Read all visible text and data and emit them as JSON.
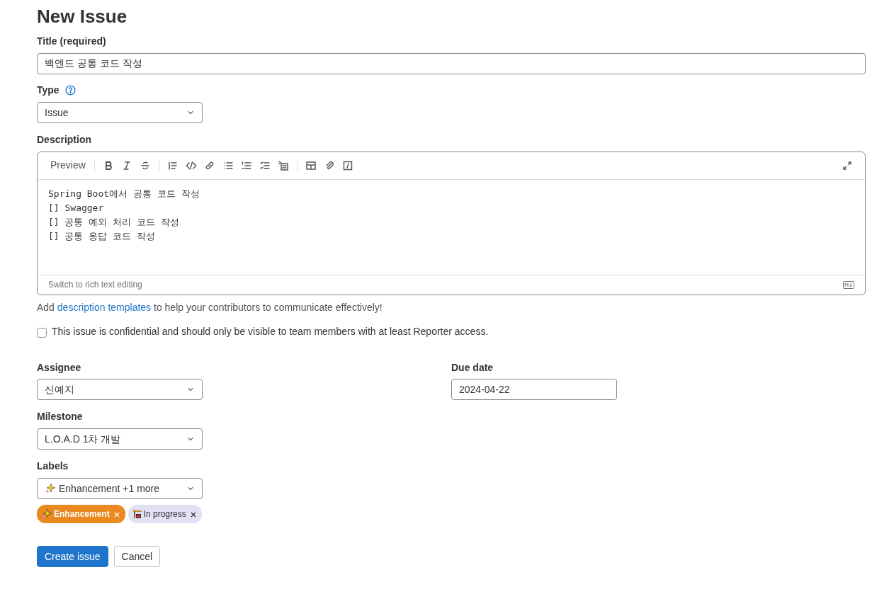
{
  "page_title": "New Issue",
  "title_field": {
    "label": "Title (required)",
    "value": "백엔드 공통 코드 작성"
  },
  "type_field": {
    "label": "Type",
    "value": "Issue"
  },
  "description": {
    "label": "Description",
    "preview_tab": "Preview",
    "content": "Spring Boot에서 공통 코드 작성\n[] Swagger\n[] 공통 예외 처리 코드 작성\n[] 공통 응답 코드 작성",
    "switch_link": "Switch to rich text editing"
  },
  "templates_hint": {
    "before": "Add ",
    "link": "description templates",
    "after": " to help your contributors to communicate effectively!"
  },
  "confidential": {
    "label": "This issue is confidential and should only be visible to team members with at least Reporter access.",
    "checked": false
  },
  "assignee": {
    "label": "Assignee",
    "value": "신예지"
  },
  "due_date": {
    "label": "Due date",
    "value": "2024-04-22"
  },
  "milestone": {
    "label": "Milestone",
    "value": "L.O.A.D 1차 개발"
  },
  "labels": {
    "label": "Labels",
    "dropdown_value": "Enhancement +1 more",
    "items": [
      {
        "name": "Enhancement",
        "color": "#e9891f"
      },
      {
        "name": "In progress",
        "color": "#e1e0f5"
      }
    ]
  },
  "buttons": [
    {
      "label": "Create issue",
      "kind": "primary"
    },
    {
      "label": "Cancel",
      "kind": "secondary"
    }
  ]
}
